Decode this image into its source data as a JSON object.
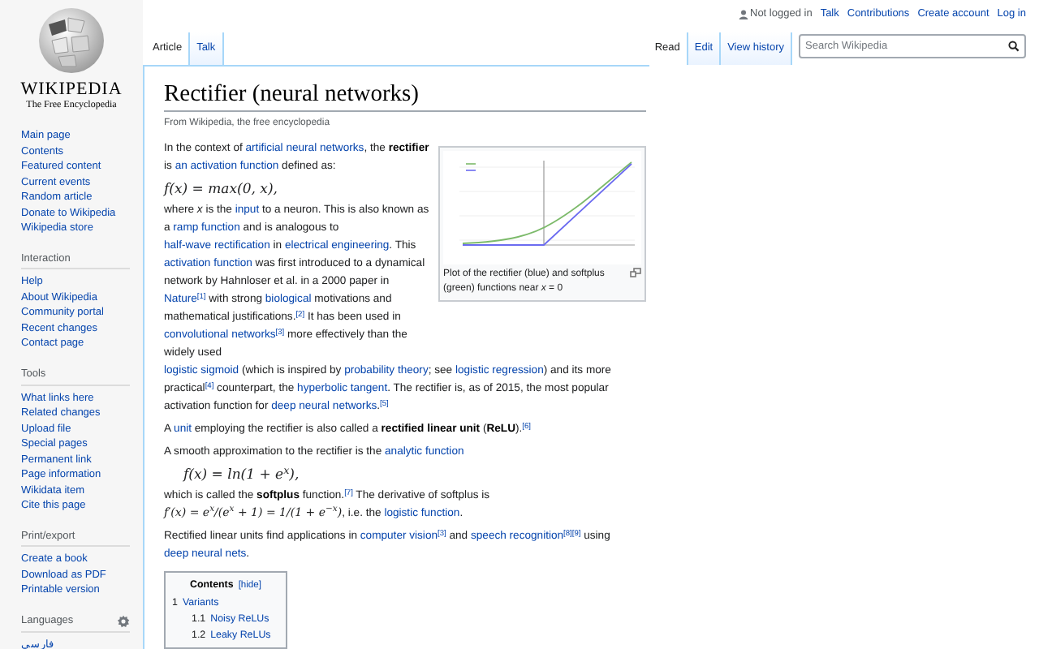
{
  "logo": {
    "wordmark": "WIKIPEDIA",
    "tagline": "The Free Encyclopedia"
  },
  "sidebar": {
    "sections": [
      {
        "items": [
          "Main page",
          "Contents",
          "Featured content",
          "Current events",
          "Random article",
          "Donate to Wikipedia",
          "Wikipedia store"
        ]
      },
      {
        "heading": "Interaction",
        "items": [
          "Help",
          "About Wikipedia",
          "Community portal",
          "Recent changes",
          "Contact page"
        ]
      },
      {
        "heading": "Tools",
        "items": [
          "What links here",
          "Related changes",
          "Upload file",
          "Special pages",
          "Permanent link",
          "Page information",
          "Wikidata item",
          "Cite this page"
        ]
      },
      {
        "heading": "Print/export",
        "items": [
          "Create a book",
          "Download as PDF",
          "Printable version"
        ]
      },
      {
        "heading": "Languages",
        "settings": true,
        "items": [
          "فارسی"
        ]
      }
    ]
  },
  "personal_links": [
    "Not logged in",
    "Talk",
    "Contributions",
    "Create account",
    "Log in"
  ],
  "namespace_tabs": [
    {
      "label": "Article",
      "selected": true
    },
    {
      "label": "Talk",
      "selected": false
    }
  ],
  "view_tabs": [
    {
      "label": "Read",
      "selected": true
    },
    {
      "label": "Edit",
      "selected": false
    },
    {
      "label": "View history",
      "selected": false
    }
  ],
  "search": {
    "placeholder": "Search Wikipedia"
  },
  "article": {
    "title": "Rectifier (neural networks)",
    "subtitle": "From Wikipedia, the free encyclopedia",
    "figure": {
      "caption": "Plot of the rectifier (blue) and softplus (green) functions near *x* = 0"
    },
    "beside_figure_blocks": [
      {
        "kind": "paragraph",
        "segments": [
          {
            "kind": "plain",
            "text": "In the context of "
          },
          {
            "kind": "link",
            "text": "artificial neural networks"
          },
          {
            "kind": "plain",
            "text": ", the "
          },
          {
            "kind": "bold",
            "text": "rectifier"
          },
          {
            "kind": "plain",
            "text": " is "
          },
          {
            "kind": "link",
            "text": "an activation function"
          },
          {
            "kind": "plain",
            "text": " defined as:"
          }
        ]
      },
      {
        "kind": "math",
        "text": "f(x) = max(0, x),",
        "indent": false
      },
      {
        "kind": "paragraph",
        "segments": [
          {
            "kind": "plain",
            "text": "where "
          },
          {
            "kind": "italic",
            "text": "x"
          },
          {
            "kind": "plain",
            "text": " is the "
          },
          {
            "kind": "link",
            "text": "input"
          },
          {
            "kind": "plain",
            "text": " to a neuron. This is also known as a "
          },
          {
            "kind": "link",
            "text": "ramp function"
          },
          {
            "kind": "plain",
            "text": " and is analogous to "
          },
          {
            "kind": "link",
            "text": "half-wave rectification"
          },
          {
            "kind": "plain",
            "text": " in "
          },
          {
            "kind": "link",
            "text": "electrical engineering"
          },
          {
            "kind": "plain",
            "text": ". This "
          },
          {
            "kind": "link",
            "text": "activation function"
          },
          {
            "kind": "plain",
            "text": " was first introduced to a dynamical network by Hahnloser et al. in a 2000 paper in "
          },
          {
            "kind": "link",
            "text": "Nature"
          },
          {
            "kind": "ref",
            "text": "[1]"
          },
          {
            "kind": "plain",
            "text": " with strong "
          },
          {
            "kind": "link",
            "text": "biological"
          },
          {
            "kind": "plain",
            "text": " motivations and mathematical justifications."
          },
          {
            "kind": "ref",
            "text": "[2]"
          },
          {
            "kind": "plain",
            "text": " It has been used in "
          },
          {
            "kind": "link",
            "text": "convolutional networks"
          },
          {
            "kind": "ref",
            "text": "[3]"
          },
          {
            "kind": "plain",
            "text": " more effectively than the widely used"
          }
        ]
      }
    ],
    "blocks": [
      {
        "kind": "paragraph",
        "segments": [
          {
            "kind": "link",
            "text": "logistic sigmoid"
          },
          {
            "kind": "plain",
            "text": " (which is inspired by "
          },
          {
            "kind": "link",
            "text": "probability theory"
          },
          {
            "kind": "plain",
            "text": "; see "
          },
          {
            "kind": "link",
            "text": "logistic regression"
          },
          {
            "kind": "plain",
            "text": ") and its more practical"
          },
          {
            "kind": "ref",
            "text": "[4]"
          },
          {
            "kind": "plain",
            "text": " counterpart, the "
          },
          {
            "kind": "link",
            "text": "hyperbolic tangent"
          },
          {
            "kind": "plain",
            "text": ". The rectifier is, as of 2015, the most popular activation function for "
          },
          {
            "kind": "link",
            "text": "deep neural networks"
          },
          {
            "kind": "plain",
            "text": "."
          },
          {
            "kind": "ref",
            "text": "[5]"
          }
        ]
      },
      {
        "kind": "paragraph",
        "segments": [
          {
            "kind": "plain",
            "text": "A "
          },
          {
            "kind": "link",
            "text": "unit"
          },
          {
            "kind": "plain",
            "text": " employing the rectifier is also called a "
          },
          {
            "kind": "bold",
            "text": "rectified linear unit"
          },
          {
            "kind": "plain",
            "text": " ("
          },
          {
            "kind": "bold",
            "text": "ReLU"
          },
          {
            "kind": "plain",
            "text": ")."
          },
          {
            "kind": "ref",
            "text": "[6]"
          }
        ]
      },
      {
        "kind": "paragraph",
        "segments": [
          {
            "kind": "plain",
            "text": "A smooth approximation to the rectifier is the "
          },
          {
            "kind": "link",
            "text": "analytic function"
          }
        ]
      },
      {
        "kind": "math",
        "text": "f(x) = ln(1 + e$^{x}$),",
        "indent": true
      },
      {
        "kind": "paragraph",
        "segments": [
          {
            "kind": "plain",
            "text": "which is called the "
          },
          {
            "kind": "bold",
            "text": "softplus"
          },
          {
            "kind": "plain",
            "text": " function."
          },
          {
            "kind": "ref",
            "text": "[7]"
          },
          {
            "kind": "plain",
            "text": " The derivative of softplus is "
          },
          {
            "kind": "math",
            "text": "f′(x) = e$^{x}$/(e$^{x}$ + 1) = 1/(1 + e$^{−x}$)"
          },
          {
            "kind": "plain",
            "text": ", i.e. the "
          },
          {
            "kind": "link",
            "text": "logistic function"
          },
          {
            "kind": "plain",
            "text": "."
          }
        ]
      },
      {
        "kind": "paragraph",
        "segments": [
          {
            "kind": "plain",
            "text": "Rectified linear units find applications in "
          },
          {
            "kind": "link",
            "text": "computer vision"
          },
          {
            "kind": "ref",
            "text": "[3]"
          },
          {
            "kind": "plain",
            "text": " and "
          },
          {
            "kind": "link",
            "text": "speech recognition"
          },
          {
            "kind": "ref",
            "text": "[8][9]"
          },
          {
            "kind": "plain",
            "text": " using "
          },
          {
            "kind": "link",
            "text": "deep neural nets"
          },
          {
            "kind": "plain",
            "text": "."
          }
        ]
      }
    ],
    "toc": {
      "title": "Contents",
      "toggle": "[hide]",
      "items": [
        {
          "number": "1",
          "label": "Variants",
          "children": [
            {
              "number": "1.1",
              "label": "Noisy ReLUs"
            },
            {
              "number": "1.2",
              "label": "Leaky ReLUs"
            }
          ]
        }
      ]
    }
  }
}
